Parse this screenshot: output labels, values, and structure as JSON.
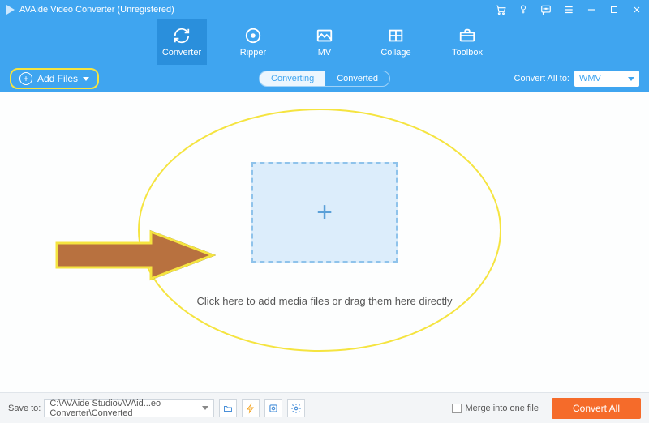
{
  "titlebar": {
    "app_title": "AVAide Video Converter (Unregistered)"
  },
  "nav": {
    "items": [
      {
        "label": "Converter",
        "icon": "refresh-icon"
      },
      {
        "label": "Ripper",
        "icon": "disc-icon"
      },
      {
        "label": "MV",
        "icon": "image-icon"
      },
      {
        "label": "Collage",
        "icon": "grid-icon"
      },
      {
        "label": "Toolbox",
        "icon": "toolbox-icon"
      }
    ]
  },
  "secbar": {
    "add_files_label": "Add Files",
    "tab_converting": "Converting",
    "tab_converted": "Converted",
    "convert_all_label": "Convert All to:",
    "format_selected": "WMV"
  },
  "main": {
    "drop_text": "Click here to add media files or drag them here directly"
  },
  "footer": {
    "save_to_label": "Save to:",
    "save_path": "C:\\AVAide Studio\\AVAid...eo Converter\\Converted",
    "merge_label": "Merge into one file",
    "convert_all_btn": "Convert All"
  }
}
